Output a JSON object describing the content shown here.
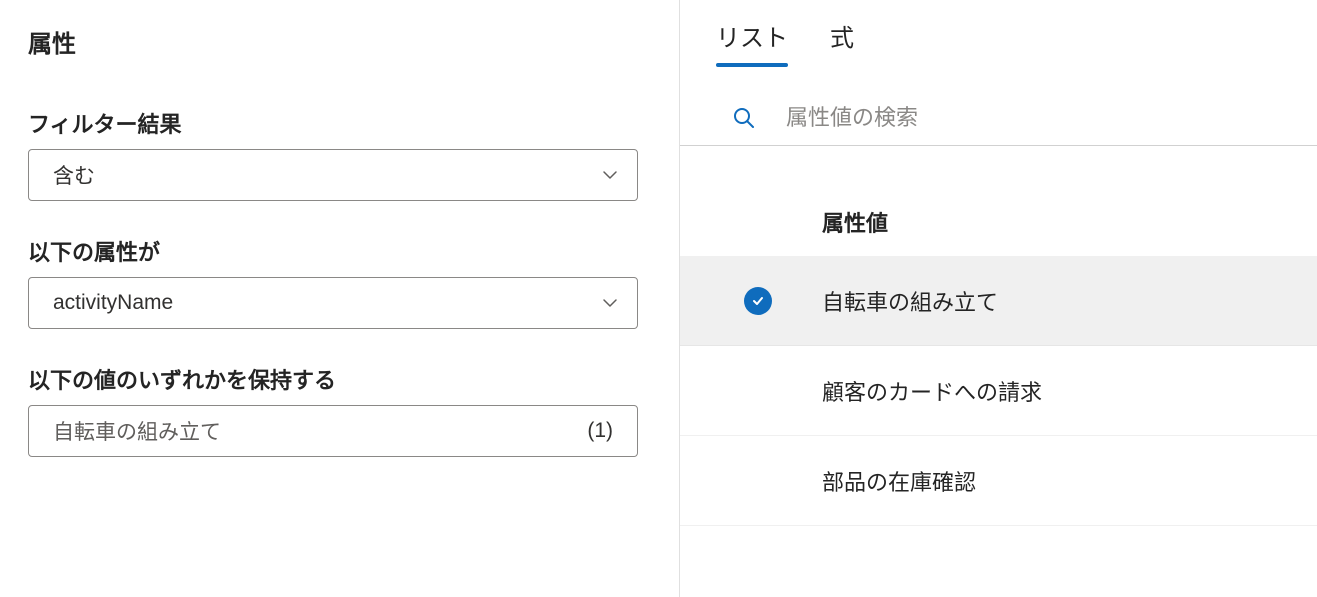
{
  "left": {
    "title": "属性",
    "filter_result_label": "フィルター結果",
    "filter_result_value": "含む",
    "attribute_label": "以下の属性が",
    "attribute_value": "activityName",
    "holds_label": "以下の値のいずれかを保持する",
    "holds_value": "自転車の組み立て",
    "holds_count": "(1)"
  },
  "right": {
    "tabs": {
      "list": "リスト",
      "expression": "式"
    },
    "search_placeholder": "属性値の検索",
    "list_header": "属性値",
    "values": [
      {
        "label": "自転車の組み立て",
        "selected": true
      },
      {
        "label": "顧客のカードへの請求",
        "selected": false
      },
      {
        "label": "部品の在庫確認",
        "selected": false
      }
    ]
  }
}
